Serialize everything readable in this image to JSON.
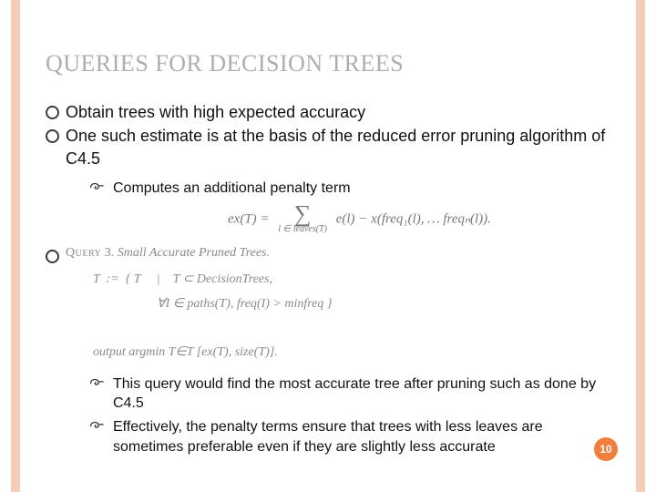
{
  "title": "QUERIES FOR DECISION TREES",
  "bullets": {
    "b1": "Obtain trees with high expected accuracy",
    "b2": "One such estimate is at the basis of the reduced error pruning algorithm of C4.5",
    "b2_sub1": "Computes an additional penalty term",
    "b3_sub1": "This query would find the most accurate tree after pruning such as done by C4.5",
    "b3_sub2": "Effectively, the penalty terms ensure that trees with less leaves are sometimes preferable even if they are slightly less accurate"
  },
  "formula": {
    "lhs": "ex(T) =",
    "sum_sub": "l ∈ leaves(T)",
    "rhs": "e(l) − x(freq₁(l), … freqₙ(l))."
  },
  "query": {
    "heading_sc": "Query",
    "heading_num": "3.",
    "heading_it": "Small Accurate Pruned Trees.",
    "line1": "T  :=  { T     |    T ⊂ DecisionTrees,",
    "line2": "                    ∀I ∈ paths(T), freq(I) > minfreq }",
    "line3": "output argmin T∈T [ex(T), size(T)]."
  },
  "page_number": "10"
}
